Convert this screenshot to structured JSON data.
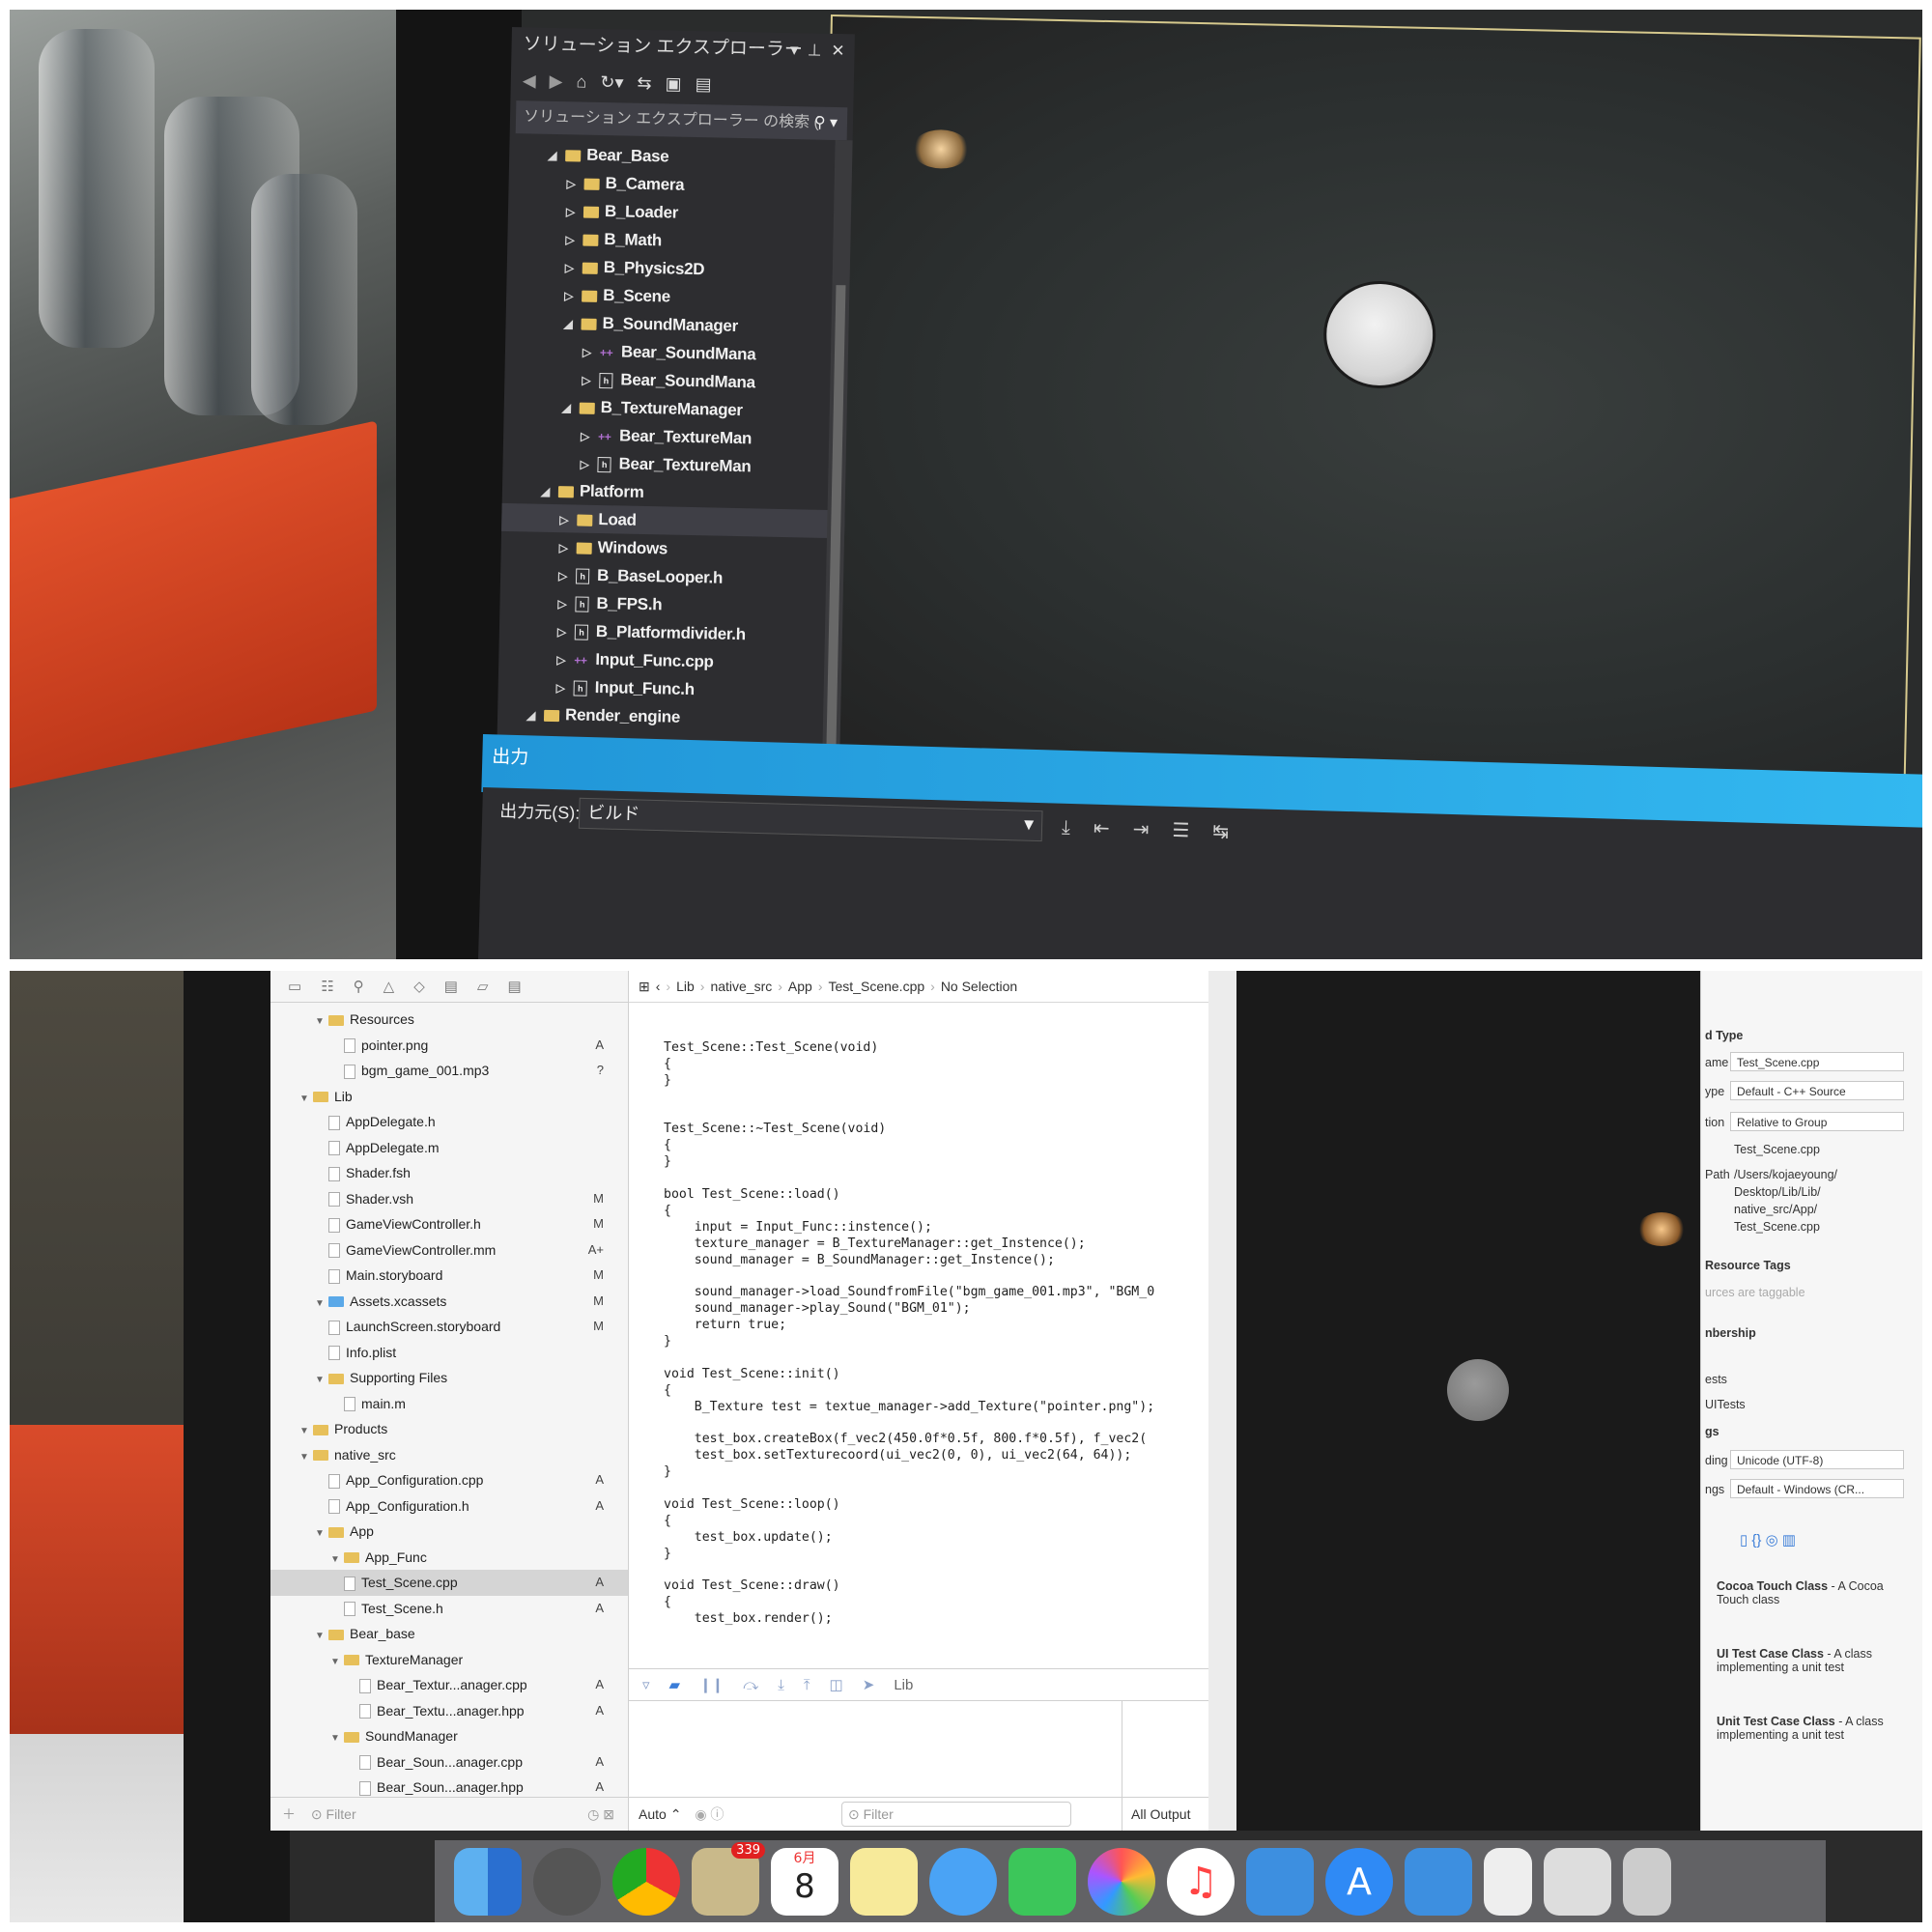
{
  "top": {
    "solution_explorer": {
      "title": "ソリューション エクスプローラー",
      "search_placeholder": "ソリューション エクスプローラー の検索 (",
      "tree": [
        {
          "label": "Bear_Base",
          "kind": "folder",
          "expanded": true
        },
        {
          "label": "B_Camera",
          "kind": "folder"
        },
        {
          "label": "B_Loader",
          "kind": "folder"
        },
        {
          "label": "B_Math",
          "kind": "folder"
        },
        {
          "label": "B_Physics2D",
          "kind": "folder"
        },
        {
          "label": "B_Scene",
          "kind": "folder"
        },
        {
          "label": "B_SoundManager",
          "kind": "folder",
          "expanded": true
        },
        {
          "label": "Bear_SoundMana",
          "kind": "cpp"
        },
        {
          "label": "Bear_SoundMana",
          "kind": "h"
        },
        {
          "label": "B_TextureManager",
          "kind": "folder",
          "expanded": true
        },
        {
          "label": "Bear_TextureMan",
          "kind": "cpp"
        },
        {
          "label": "Bear_TextureMan",
          "kind": "h"
        },
        {
          "label": "Platform",
          "kind": "folder",
          "expanded": true
        },
        {
          "label": "Load",
          "kind": "folder",
          "selected": true
        },
        {
          "label": "Windows",
          "kind": "folder"
        },
        {
          "label": "B_BaseLooper.h",
          "kind": "h"
        },
        {
          "label": "B_FPS.h",
          "kind": "h"
        },
        {
          "label": "B_Platformdivider.h",
          "kind": "h"
        },
        {
          "label": "Input_Func.cpp",
          "kind": "cpp"
        },
        {
          "label": "Input_Func.h",
          "kind": "h"
        },
        {
          "label": "Render_engine",
          "kind": "folder",
          "expanded": true
        }
      ]
    },
    "output": {
      "title": "出力",
      "source_label": "出力元(S):",
      "source_value": "ビルド"
    }
  },
  "bottom": {
    "navigator": {
      "rows": [
        {
          "label": "Resources",
          "kind": "folder",
          "depth": 1,
          "badge": ""
        },
        {
          "label": "pointer.png",
          "kind": "file",
          "depth": 2,
          "badge": "A"
        },
        {
          "label": "bgm_game_001.mp3",
          "kind": "file",
          "depth": 2,
          "badge": "?"
        },
        {
          "label": "Lib",
          "kind": "folder",
          "depth": 0,
          "badge": ""
        },
        {
          "label": "AppDelegate.h",
          "kind": "file",
          "depth": 1,
          "badge": ""
        },
        {
          "label": "AppDelegate.m",
          "kind": "file",
          "depth": 1,
          "badge": ""
        },
        {
          "label": "Shader.fsh",
          "kind": "file",
          "depth": 1,
          "badge": ""
        },
        {
          "label": "Shader.vsh",
          "kind": "file",
          "depth": 1,
          "badge": "M"
        },
        {
          "label": "GameViewController.h",
          "kind": "file",
          "depth": 1,
          "badge": "M"
        },
        {
          "label": "GameViewController.mm",
          "kind": "file",
          "depth": 1,
          "badge": "A+"
        },
        {
          "label": "Main.storyboard",
          "kind": "file",
          "depth": 1,
          "badge": "M"
        },
        {
          "label": "Assets.xcassets",
          "kind": "folder-blue",
          "depth": 1,
          "badge": "M"
        },
        {
          "label": "LaunchScreen.storyboard",
          "kind": "file",
          "depth": 1,
          "badge": "M"
        },
        {
          "label": "Info.plist",
          "kind": "file",
          "depth": 1,
          "badge": ""
        },
        {
          "label": "Supporting Files",
          "kind": "folder",
          "depth": 1,
          "badge": ""
        },
        {
          "label": "main.m",
          "kind": "file",
          "depth": 2,
          "badge": ""
        },
        {
          "label": "Products",
          "kind": "folder",
          "depth": 0,
          "badge": ""
        },
        {
          "label": "native_src",
          "kind": "folder",
          "depth": 0,
          "badge": ""
        },
        {
          "label": "App_Configuration.cpp",
          "kind": "file",
          "depth": 1,
          "badge": "A"
        },
        {
          "label": "App_Configuration.h",
          "kind": "file",
          "depth": 1,
          "badge": "A"
        },
        {
          "label": "App",
          "kind": "folder",
          "depth": 1,
          "badge": ""
        },
        {
          "label": "App_Func",
          "kind": "folder",
          "depth": 2,
          "badge": ""
        },
        {
          "label": "Test_Scene.cpp",
          "kind": "file",
          "depth": 2,
          "badge": "A",
          "selected": true
        },
        {
          "label": "Test_Scene.h",
          "kind": "file",
          "depth": 2,
          "badge": "A"
        },
        {
          "label": "Bear_base",
          "kind": "folder",
          "depth": 1,
          "badge": ""
        },
        {
          "label": "TextureManager",
          "kind": "folder",
          "depth": 2,
          "badge": ""
        },
        {
          "label": "Bear_Textur...anager.cpp",
          "kind": "file",
          "depth": 3,
          "badge": "A"
        },
        {
          "label": "Bear_Textu...anager.hpp",
          "kind": "file",
          "depth": 3,
          "badge": "A"
        },
        {
          "label": "SoundManager",
          "kind": "folder",
          "depth": 2,
          "badge": ""
        },
        {
          "label": "Bear_Soun...anager.cpp",
          "kind": "file",
          "depth": 3,
          "badge": "A"
        },
        {
          "label": "Bear_Soun...anager.hpp",
          "kind": "file",
          "depth": 3,
          "badge": "A"
        }
      ],
      "filter_placeholder": "Filter"
    },
    "jumpbar": {
      "crumbs": [
        "Lib",
        "native_src",
        "App",
        "Test_Scene.cpp",
        "No Selection"
      ]
    },
    "code_lines": [
      "Test_Scene::Test_Scene(void)",
      "{",
      "}",
      "",
      "",
      "Test_Scene::~Test_Scene(void)",
      "{",
      "}",
      "",
      "bool Test_Scene::load()",
      "{",
      "    input = Input_Func::instence();",
      "    texture_manager = B_TextureManager::get_Instence();",
      "    sound_manager = B_SoundManager::get_Instence();",
      "",
      "    sound_manager->load_SoundfromFile(\"bgm_game_001.mp3\", \"BGM_0",
      "    sound_manager->play_Sound(\"BGM_01\");",
      "    return true;",
      "}",
      "",
      "void Test_Scene::init()",
      "{",
      "    B_Texture test = textue_manager->add_Texture(\"pointer.png\");",
      "",
      "    test_box.createBox(f_vec2(450.0f*0.5f, 800.f*0.5f), f_vec2(",
      "    test_box.setTexturecoord(ui_vec2(0, 0), ui_vec2(64, 64));",
      "}",
      "",
      "void Test_Scene::loop()",
      "{",
      "    test_box.update();",
      "}",
      "",
      "void Test_Scene::draw()",
      "{",
      "    test_box.render();"
    ],
    "debug_bar": {
      "target": "Lib"
    },
    "console": {
      "mode": "Auto",
      "filter_placeholder": "Filter",
      "output": "All Output"
    },
    "inspector": {
      "identity_type_title": "d Type",
      "name_label": "ame",
      "name_value": "Test_Scene.cpp",
      "type_label": "ype",
      "type_value": "Default - C++ Source",
      "location_label": "tion",
      "location_value": "Relative to Group",
      "location_file": "Test_Scene.cpp",
      "path_label": "Path",
      "path_lines": [
        "/Users/kojaeyoung/",
        "Desktop/Lib/Lib/",
        "native_src/App/",
        "Test_Scene.cpp"
      ],
      "resource_tags_title": "Resource Tags",
      "resource_tags_placeholder": "urces are taggable",
      "membership_title": "nbership",
      "targets": [
        "ests",
        "UITests"
      ],
      "text_settings_title": "gs",
      "encoding_label": "ding",
      "encoding_value": "Unicode (UTF-8)",
      "line_endings_label": "ngs",
      "line_endings_value": "Default - Windows (CR...",
      "library": [
        {
          "name": "Cocoa Touch Class",
          "desc": " - A Cocoa",
          "desc2": "Touch class"
        },
        {
          "name": "UI Test Case Class",
          "desc": " - A class",
          "desc2": "implementing a unit test"
        },
        {
          "name": "Unit Test Case Class",
          "desc": " - A class",
          "desc2": "implementing a unit test"
        }
      ]
    },
    "dock": {
      "mail_badge": "339",
      "calendar_month": "6月",
      "calendar_day": "8"
    }
  }
}
